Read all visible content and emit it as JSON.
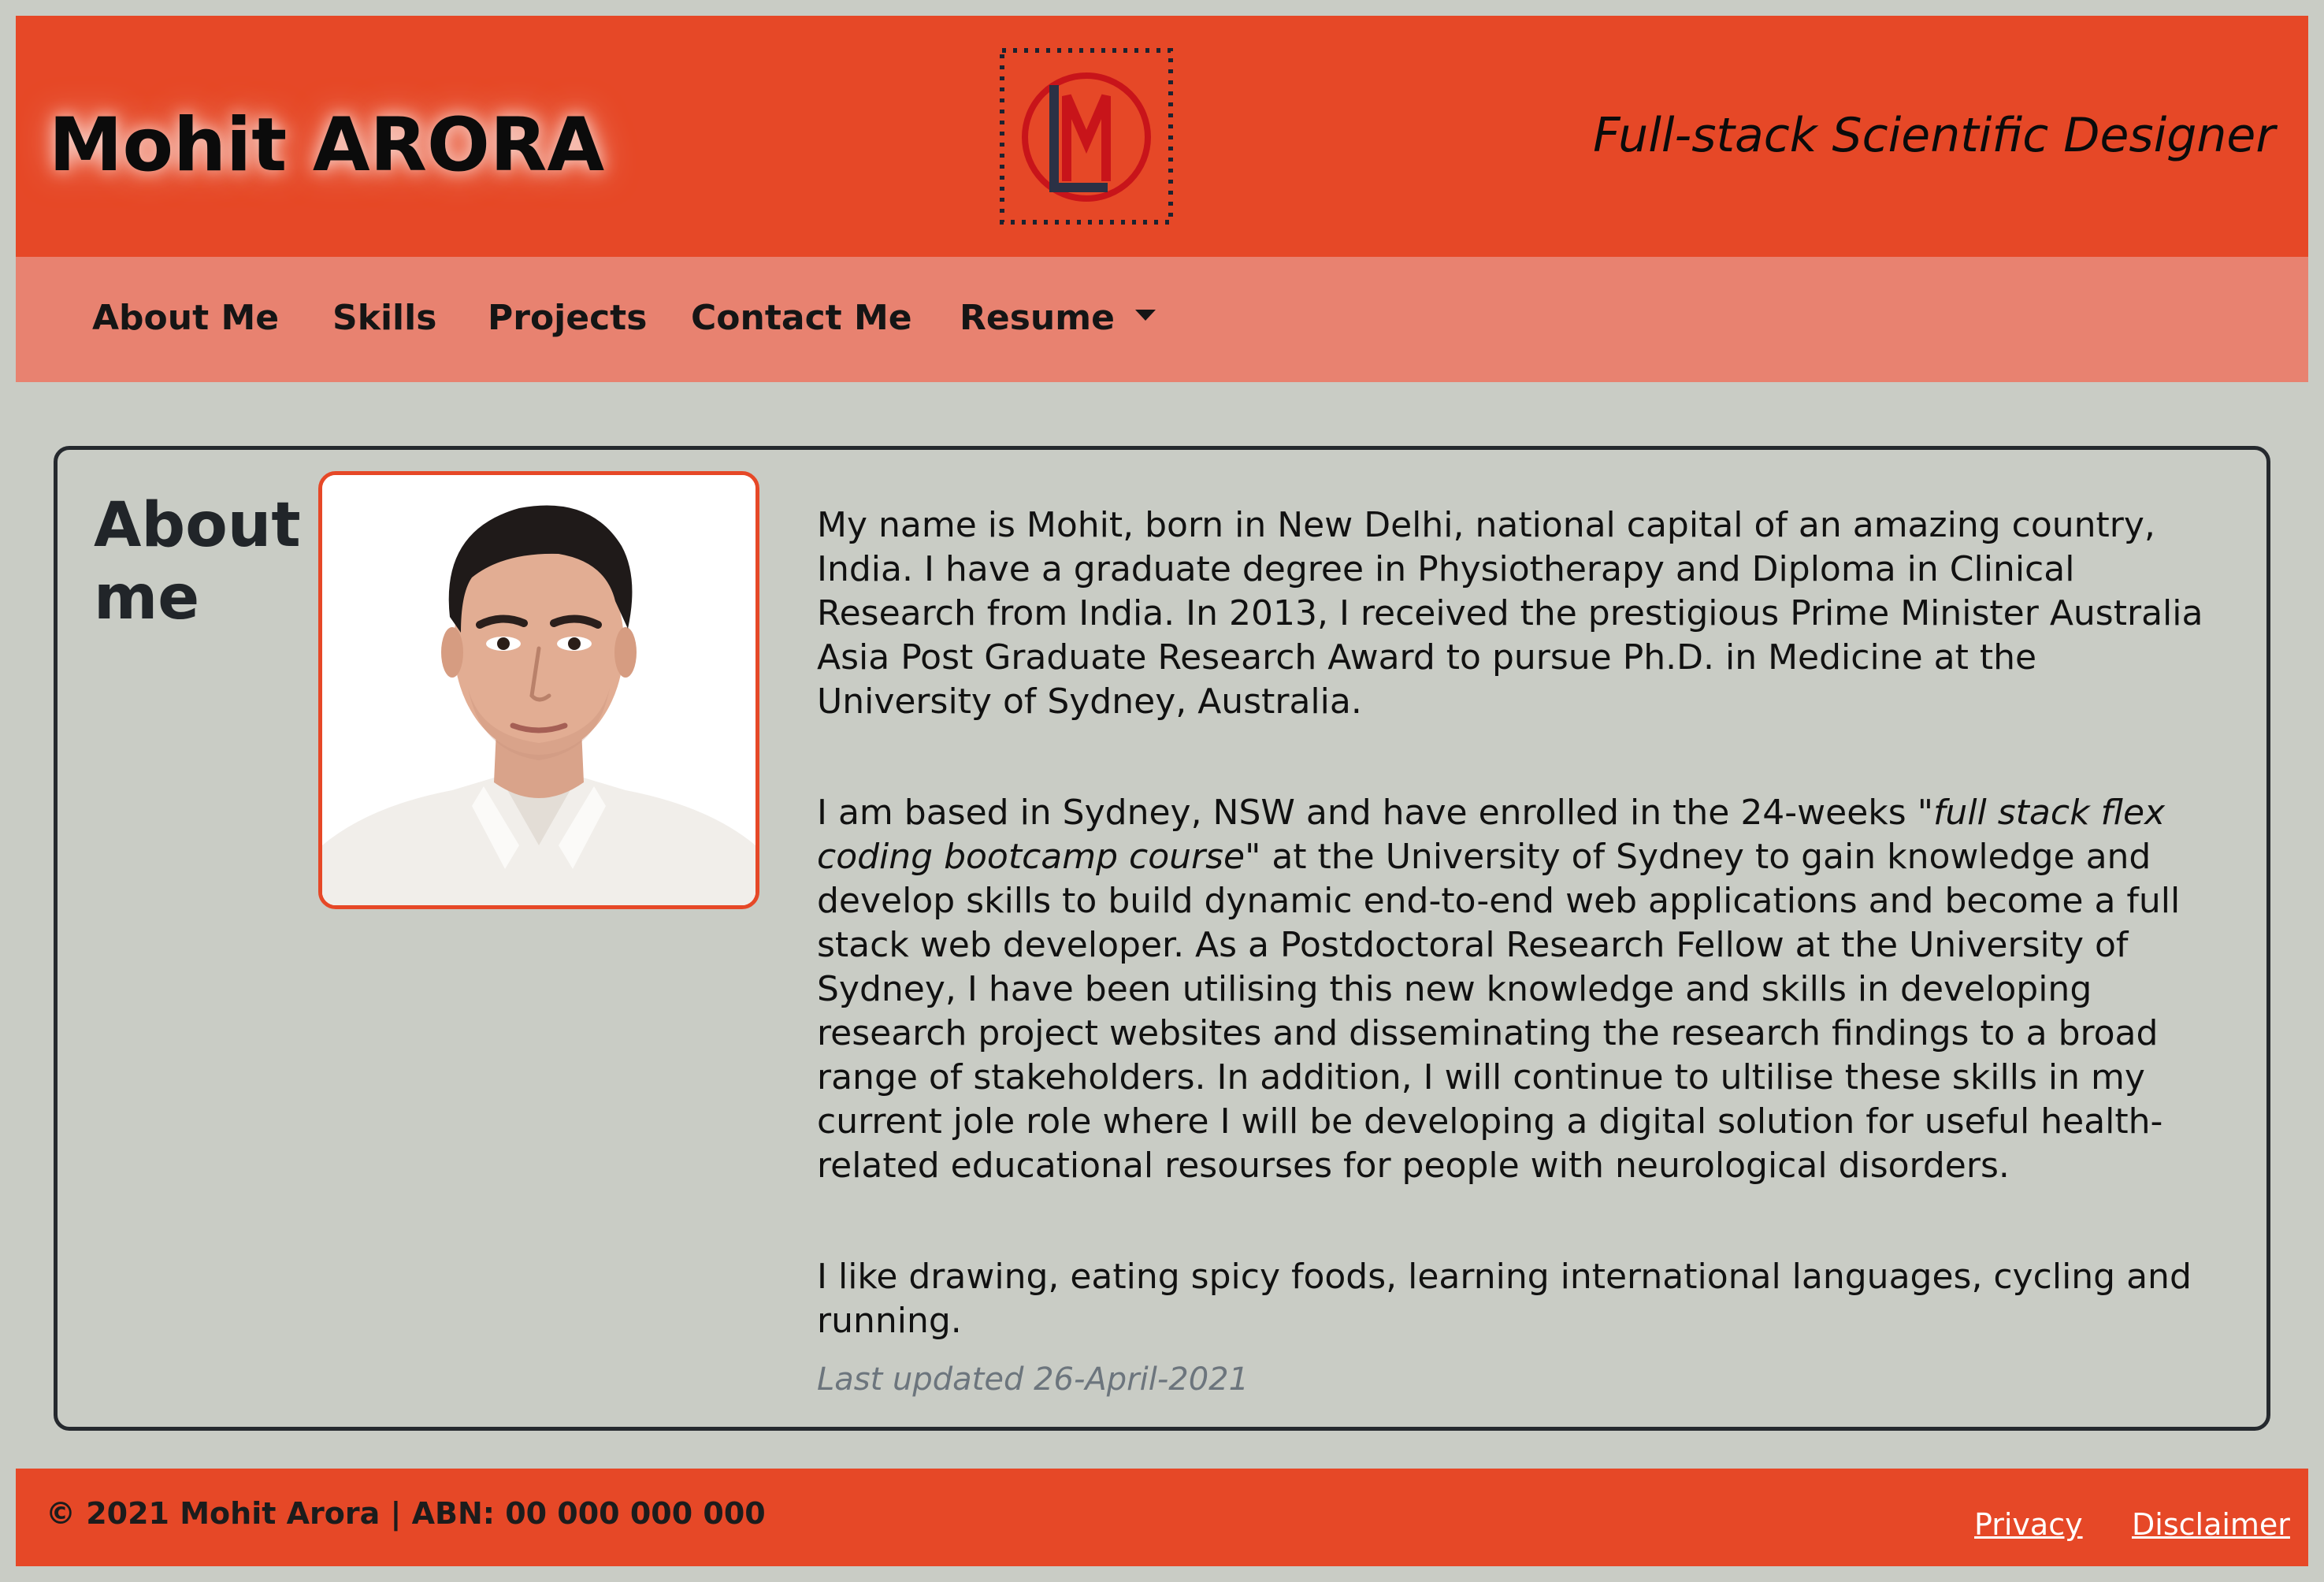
{
  "header": {
    "site_name": "Mohit ARORA",
    "logo": "ML-monogram-logo",
    "tagline": "Full-stack Scientific Designer"
  },
  "nav": {
    "items": [
      {
        "label": "About Me"
      },
      {
        "label": "Skills"
      },
      {
        "label": "Projects"
      },
      {
        "label": "Contact Me"
      },
      {
        "label": "Resume",
        "icon": "caret-down-icon"
      }
    ]
  },
  "about": {
    "title": "About me",
    "photo": "profile-photo",
    "paragraphs": [
      "My name is Mohit, born in New Delhi, national capital of an amazing country, India. I have a graduate degree in Physiotherapy and Diploma in Clinical Research from India. In 2013, I received the prestigious Prime Minister Australia Asia Post Graduate Research Award to pursue Ph.D. in Medicine at the University of Sydney, Australia.",
      {
        "before": "I am based in Sydney, NSW and have enrolled in the 24-weeks \"",
        "italic": "full stack flex coding bootcamp course",
        "after": "\" at the University of Sydney to gain knowledge and develop skills to build dynamic end-to-end web applications and become a full stack web developer. As a Postdoctoral Research Fellow at the University of Sydney, I have been utilising this new knowledge and skills in developing research project websites and disseminating the research findings to a broad range of stakeholders. In addition, I will continue to ultilise these skills in my current jole role where I will be developing a digital solution for useful health-related educational resourses for people with neurological disorders."
      },
      "I like drawing, eating spicy foods, learning international languages, cycling and running."
    ],
    "last_updated": "Last updated 26-April-2021"
  },
  "footer": {
    "copyright": "© 2021 Mohit Arora | ABN: 00 000 000 000",
    "links": [
      "Privacy",
      "Disclaimer"
    ]
  },
  "colors": {
    "header_bg": "#e64827",
    "nav_bg": "#e88270",
    "page_bg": "#c9ccc5",
    "card_border": "#25292e",
    "muted_text": "#6c757d"
  }
}
